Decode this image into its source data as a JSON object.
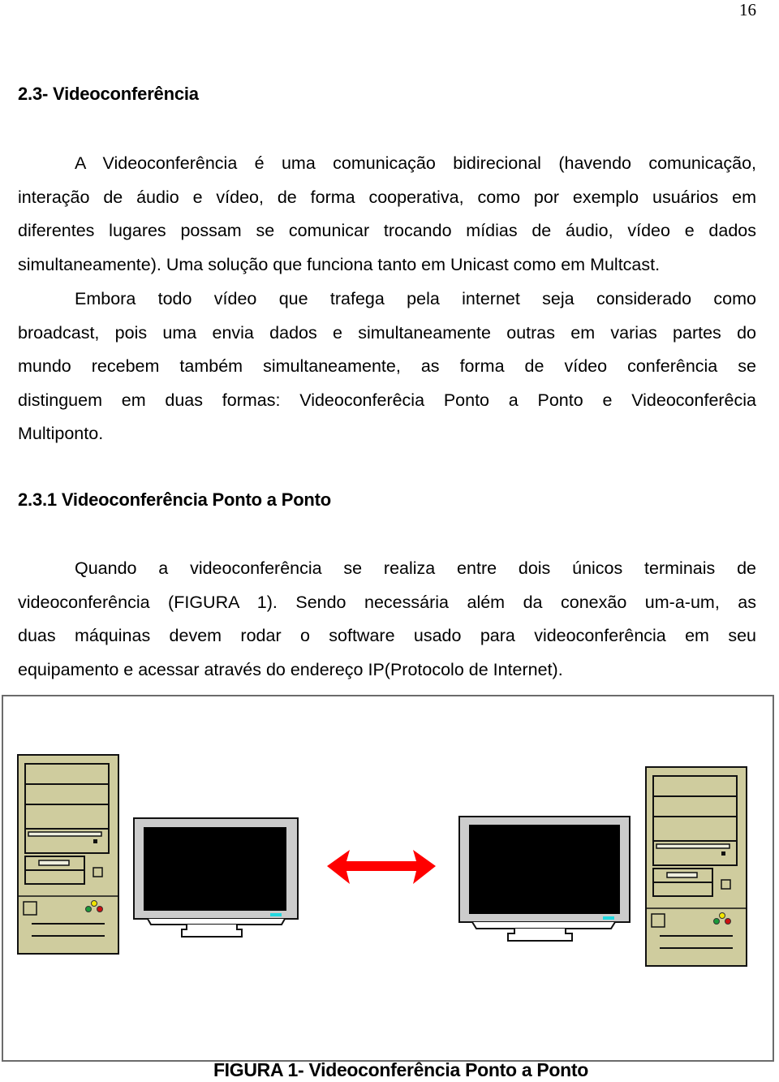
{
  "page": {
    "number": "16"
  },
  "section": {
    "heading": "2.3- Videoconferência",
    "paragraph1_lines": [
      "A Videoconferência é uma comunicação bidirecional (havendo comunicação,",
      "interação de áudio e vídeo, de forma cooperativa, como por exemplo usuários em",
      "diferentes lugares possam se comunicar trocando mídias de áudio, vídeo e dados",
      "simultaneamente). Uma solução que funciona tanto em Unicast como em Multcast."
    ],
    "paragraph2_lines": [
      "Embora todo vídeo que trafega pela internet seja considerado como",
      "broadcast, pois uma envia dados e simultaneamente outras em varias partes do",
      "mundo recebem também simultaneamente, as forma de vídeo conferência se",
      "distinguem em duas formas: Videoconferêcia Ponto a Ponto e Videoconferêcia",
      "Multiponto."
    ]
  },
  "subsection": {
    "heading": "2.3.1 Videoconferência Ponto a Ponto",
    "paragraph_lines": [
      "Quando a videoconferência se realiza entre dois únicos terminais de",
      "videoconferência (FIGURA 1). Sendo necessária além da conexão um-a-um, as",
      "duas máquinas devem rodar o software usado para videoconferência em seu",
      "equipamento e acessar através do endereço IP(Protocolo de Internet)."
    ]
  },
  "figure": {
    "caption": "FIGURA 1- Videoconferência Ponto a Ponto",
    "elements": [
      "computer-tower-icon",
      "monitor-icon",
      "bidirectional-arrow-icon",
      "monitor-icon",
      "computer-tower-icon"
    ],
    "colors": {
      "tower_body": "#cfcc9e",
      "monitor_bezel": "#cccccc",
      "screen": "#000000",
      "arrow": "#ff0000",
      "led_yellow": "#f2e600",
      "led_green": "#1a9a3a",
      "led_red": "#cc1010",
      "monitor_logo": "#22d8e0",
      "frame_border": "#6b6b6b"
    }
  }
}
